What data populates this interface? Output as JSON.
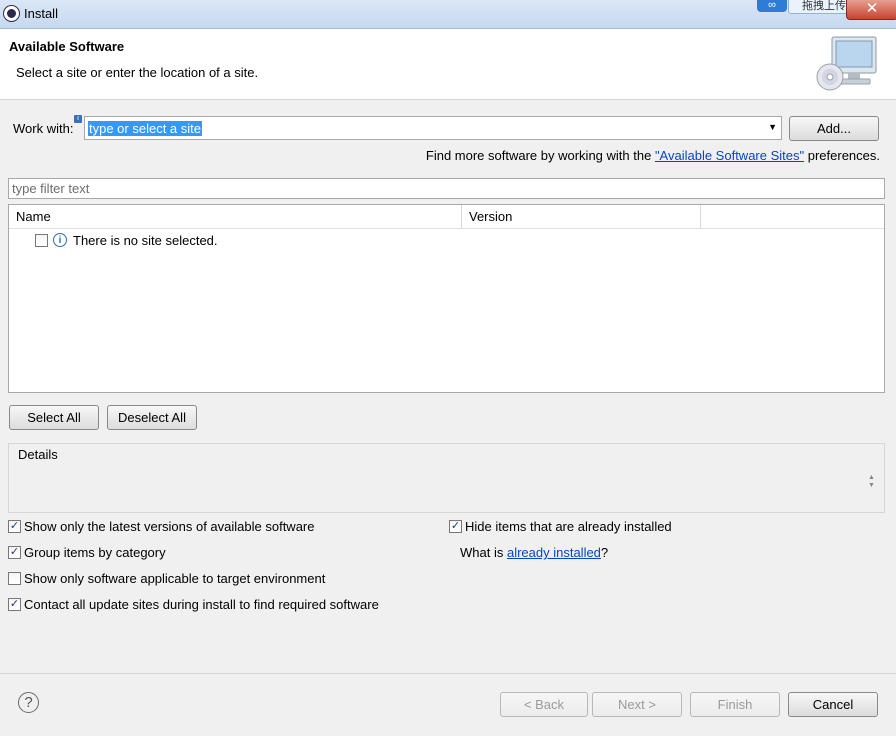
{
  "window": {
    "title": "Install",
    "close_label": "✕",
    "overlay_upload_label": "拖拽上传",
    "overlay_cloud_label": "∞"
  },
  "header": {
    "title": "Available Software",
    "subtitle": "Select a site or enter the location of a site."
  },
  "work_with": {
    "label": "Work with:",
    "value": "type or select a site",
    "add_button": "Add..."
  },
  "find_more": {
    "prefix": "Find more software by working with the ",
    "link": "\"Available Software Sites\"",
    "suffix": " preferences."
  },
  "filter": {
    "placeholder": "type filter text"
  },
  "table": {
    "columns": [
      "Name",
      "Version"
    ],
    "message": "There is no site selected."
  },
  "selection_buttons": {
    "select_all": "Select All",
    "deselect_all": "Deselect All"
  },
  "details": {
    "label": "Details"
  },
  "options": {
    "latest_versions": {
      "label": "Show only the latest versions of available software",
      "checked": true
    },
    "group_by_category": {
      "label": "Group items by category",
      "checked": true
    },
    "target_env": {
      "label": "Show only software applicable to target environment",
      "checked": false
    },
    "contact_sites": {
      "label": "Contact all update sites during install to find required software",
      "checked": true
    },
    "hide_installed": {
      "label": "Hide items that are already installed",
      "checked": true
    },
    "what_is": {
      "prefix": "What is ",
      "link": "already installed",
      "suffix": "?"
    }
  },
  "footer": {
    "help": "?",
    "back": "< Back",
    "next": "Next >",
    "finish": "Finish",
    "cancel": "Cancel"
  },
  "colors": {
    "selection": "#3399ff",
    "link": "#0645c8",
    "header_bg": "#ffffff",
    "dialog_bg": "#f0f0f0"
  }
}
